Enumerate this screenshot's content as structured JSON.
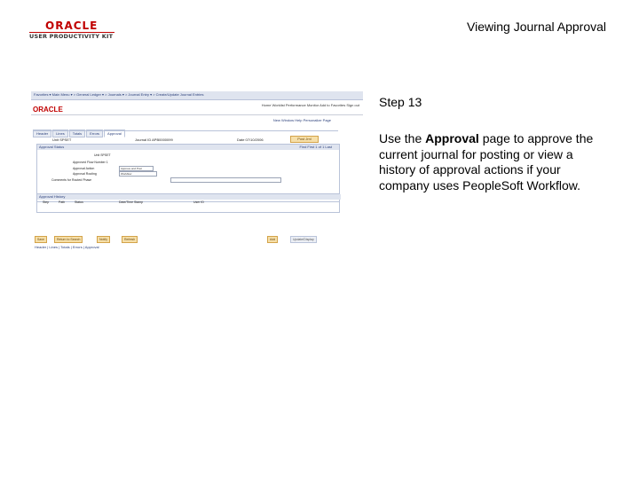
{
  "header": {
    "logo_brand": "ORACLE",
    "logo_product": "USER PRODUCTIVITY KIT",
    "doc_title": "Viewing Journal Approval"
  },
  "step": {
    "label": "Step 13"
  },
  "description": {
    "before": "Use the ",
    "bold": "Approval",
    "after": " page to approve the current journal for posting or view a history of approval actions if your company uses PeopleSoft Workflow."
  },
  "screenshot": {
    "nav_breadcrumbs": "Favorites ▾   Main Menu ▾   > General Ledger ▾   > Journals ▾   > Journal Entry ▾   > Create/Update Journal Entries",
    "brand": "ORACLE",
    "top_links": "Home    Worklist    Performance Monitor    Add to Favorites    Sign out",
    "toolbar": "New Window  Help  Personalize Page",
    "tabs": [
      "Header",
      "Lines",
      "Totals",
      "Errors",
      "Approval"
    ],
    "active_tab_index": 4,
    "unit_line": "Unit  SPSET",
    "journal_line": "Journal ID  APB0000099",
    "date_line": "Date  07/10/2006",
    "post_button": "Post Jrnl",
    "approval_status_title": "Approval Status",
    "approval_status_nav": "Find   First  1 of 1  Last",
    "fields": [
      {
        "label": "Unit  SPSET",
        "value": ""
      },
      {
        "label": "Approved Flow Number  1",
        "value": ""
      },
      {
        "label": "Approval Action",
        "value": "Approve and Post"
      },
      {
        "label": "Approval Routing",
        "value": "Workflow"
      },
      {
        "label": "Comments for Routed Phase",
        "value": ""
      }
    ],
    "history_title": "Approval History",
    "history_columns": [
      "Step",
      "Path",
      "Status",
      "Date/Time Stamp",
      "User ID"
    ],
    "buttons": [
      "Save",
      "Return to Search",
      "Notify",
      "Refresh"
    ],
    "buttons_right": [
      "Add",
      "Update/Display"
    ],
    "bottom_links": "Header | Lines | Totals | Errors | Approval"
  }
}
